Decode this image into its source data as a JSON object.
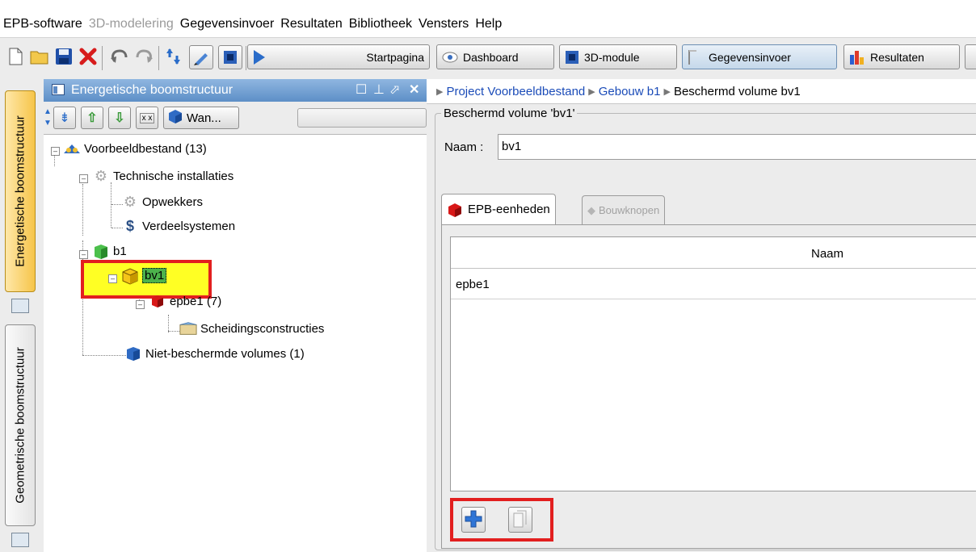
{
  "window_title_fragment": "—",
  "menu": {
    "items": [
      {
        "label": "EPB-software",
        "enabled": true
      },
      {
        "label": "3D-modelering",
        "enabled": false
      },
      {
        "label": "Gegevensinvoer",
        "enabled": true
      },
      {
        "label": "Resultaten",
        "enabled": true
      },
      {
        "label": "Bibliotheek",
        "enabled": true
      },
      {
        "label": "Vensters",
        "enabled": true
      },
      {
        "label": "Help",
        "enabled": true
      }
    ]
  },
  "toolbar": {
    "icons": [
      "new-file-icon",
      "open-folder-icon",
      "save-icon",
      "delete-icon",
      "undo-icon",
      "redo-icon",
      "refresh-icon",
      "edit-icon",
      "view-icon"
    ],
    "buttons": {
      "startpagina": "Startpagina",
      "dashboard": "Dashboard",
      "module3d": "3D-module",
      "gegevensinvoer": "Gegevensinvoer",
      "resultaten": "Resultaten"
    },
    "active_button": "gegevensinvoer"
  },
  "side_tabs": {
    "energetic": "Energetische boomstructuur",
    "geometric": "Geometrische boomstructuur"
  },
  "tree_panel": {
    "title": "Energetische boomstructuur",
    "controls": [
      "maximize-icon",
      "pin-icon",
      "undock-icon",
      "close-icon"
    ],
    "tool_button_label": "Wan...",
    "nodes": {
      "root": "Voorbeeldbestand (13)",
      "technische": "Technische installaties",
      "opwekkers": "Opwekkers",
      "verdeel": "Verdeelsystemen",
      "b1": "b1",
      "bv1": "bv1",
      "epbe1": "epbe1 (7)",
      "scheiding": "Scheidingsconstructies",
      "niet": "Niet-beschermde volumes (1)"
    },
    "selected_node": "bv1"
  },
  "detail": {
    "breadcrumb": [
      {
        "label": "Project Voorbeeldbestand",
        "link": true
      },
      {
        "label": "Gebouw b1",
        "link": true
      },
      {
        "label": "Beschermd volume bv1",
        "link": false
      }
    ],
    "group_title": "Beschermd volume 'bv1'",
    "naam_label": "Naam :",
    "naam_value": "bv1",
    "tabs": [
      {
        "label": "EPB-eenheden",
        "selected": true,
        "enabled": true
      },
      {
        "label": "Bouwknopen",
        "selected": false,
        "enabled": false
      }
    ],
    "table": {
      "column": "Naam",
      "rows": [
        "epbe1"
      ]
    },
    "actions": [
      "add-icon",
      "copy-icon"
    ]
  },
  "colors": {
    "highlight": "#ffff24",
    "annotation_border": "#e21f1f",
    "panel_header": "#6f9fd3",
    "link": "#1a4bb8"
  }
}
